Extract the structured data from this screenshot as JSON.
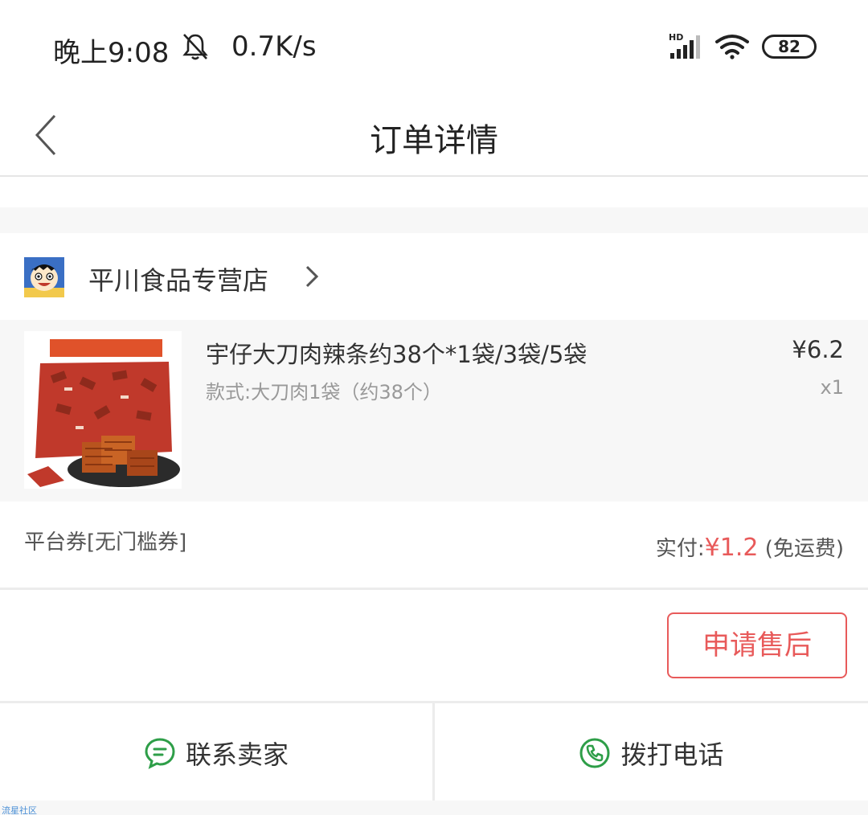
{
  "status_bar": {
    "time": "晚上9:08",
    "net_speed": "0.7K/s",
    "battery": "82",
    "icons": [
      "bell-off-icon",
      "hd-signal-icon",
      "wifi-icon",
      "battery-icon"
    ]
  },
  "nav": {
    "title": "订单详情",
    "back_icon": "chevron-left-icon"
  },
  "store": {
    "name": "平川食品专营店",
    "chevron_icon": "chevron-right-icon"
  },
  "product": {
    "title": "宇仔大刀肉辣条约38个*1袋/3袋/5袋",
    "spec": "款式:大刀肉1袋（约38个）",
    "price": "¥6.2",
    "quantity": "x1"
  },
  "payment": {
    "coupon": "平台券[无门槛券]",
    "paid_label": "实付:",
    "paid_amount": "¥1.2",
    "shipping_note": "(免运费)"
  },
  "after_sales": {
    "button_label": "申请售后"
  },
  "actions": {
    "contact_label": "联系卖家",
    "call_label": "拨打电话"
  },
  "watermark": "流星社区",
  "colors": {
    "accent_red": "#e85a5a",
    "action_green": "#2e9e48",
    "background_gray": "#f7f7f7"
  }
}
